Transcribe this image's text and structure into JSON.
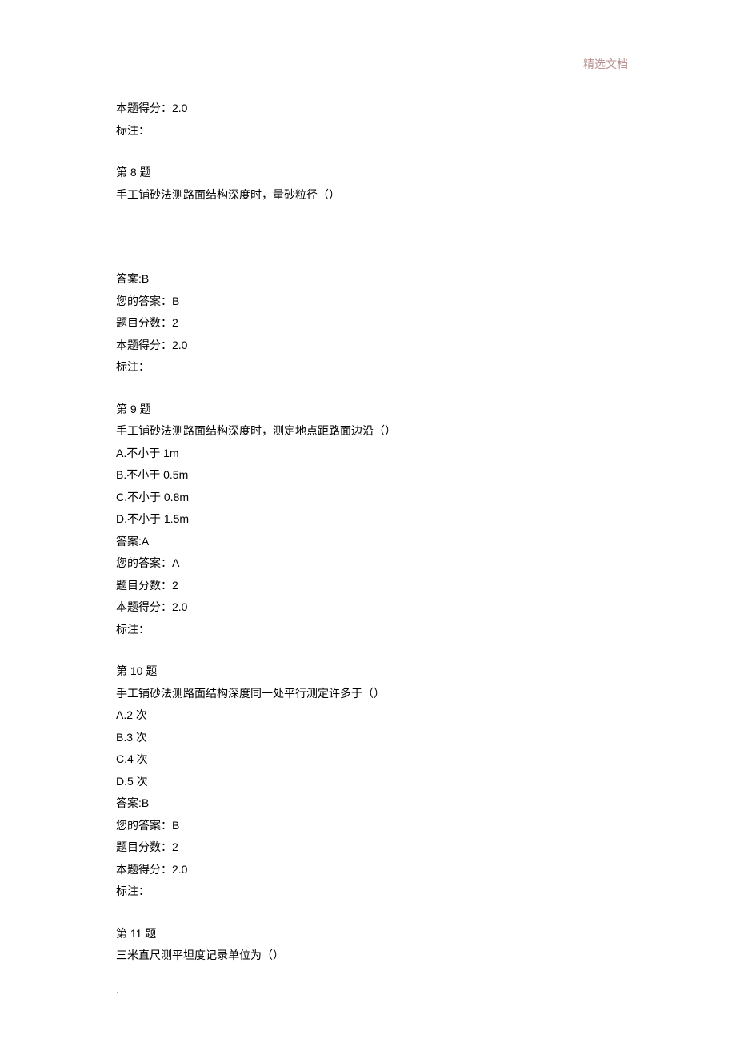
{
  "header": {
    "watermark": "精选文档"
  },
  "q7_tail": {
    "obtained_score_label": "本题得分：2.0",
    "note_label": "标注："
  },
  "q8": {
    "title": "第 8 题",
    "stem": "手工铺砂法测路面结构深度时，量砂粒径（）",
    "answer_label": "答案:B",
    "your_answer_label": "您的答案：B",
    "question_score_label": "题目分数：2",
    "obtained_score_label": "本题得分：2.0",
    "note_label": "标注："
  },
  "q9": {
    "title": "第 9 题",
    "stem": "手工铺砂法测路面结构深度时，测定地点距路面边沿（）",
    "optA": "A.不小于 1m",
    "optB": "B.不小于 0.5m",
    "optC": "C.不小于 0.8m",
    "optD": "D.不小于 1.5m",
    "answer_label": "答案:A",
    "your_answer_label": "您的答案：A",
    "question_score_label": "题目分数：2",
    "obtained_score_label": "本题得分：2.0",
    "note_label": "标注："
  },
  "q10": {
    "title": "第 10 题",
    "stem": "手工铺砂法测路面结构深度同一处平行测定许多于（）",
    "optA": "A.2 次",
    "optB": "B.3 次",
    "optC": "C.4 次",
    "optD": "D.5 次",
    "answer_label": "答案:B",
    "your_answer_label": "您的答案：B",
    "question_score_label": "题目分数：2",
    "obtained_score_label": "本题得分：2.0",
    "note_label": "标注："
  },
  "q11": {
    "title": "第 11 题",
    "stem": "三米直尺测平坦度记录单位为（）"
  },
  "footer": {
    "dot": "."
  }
}
